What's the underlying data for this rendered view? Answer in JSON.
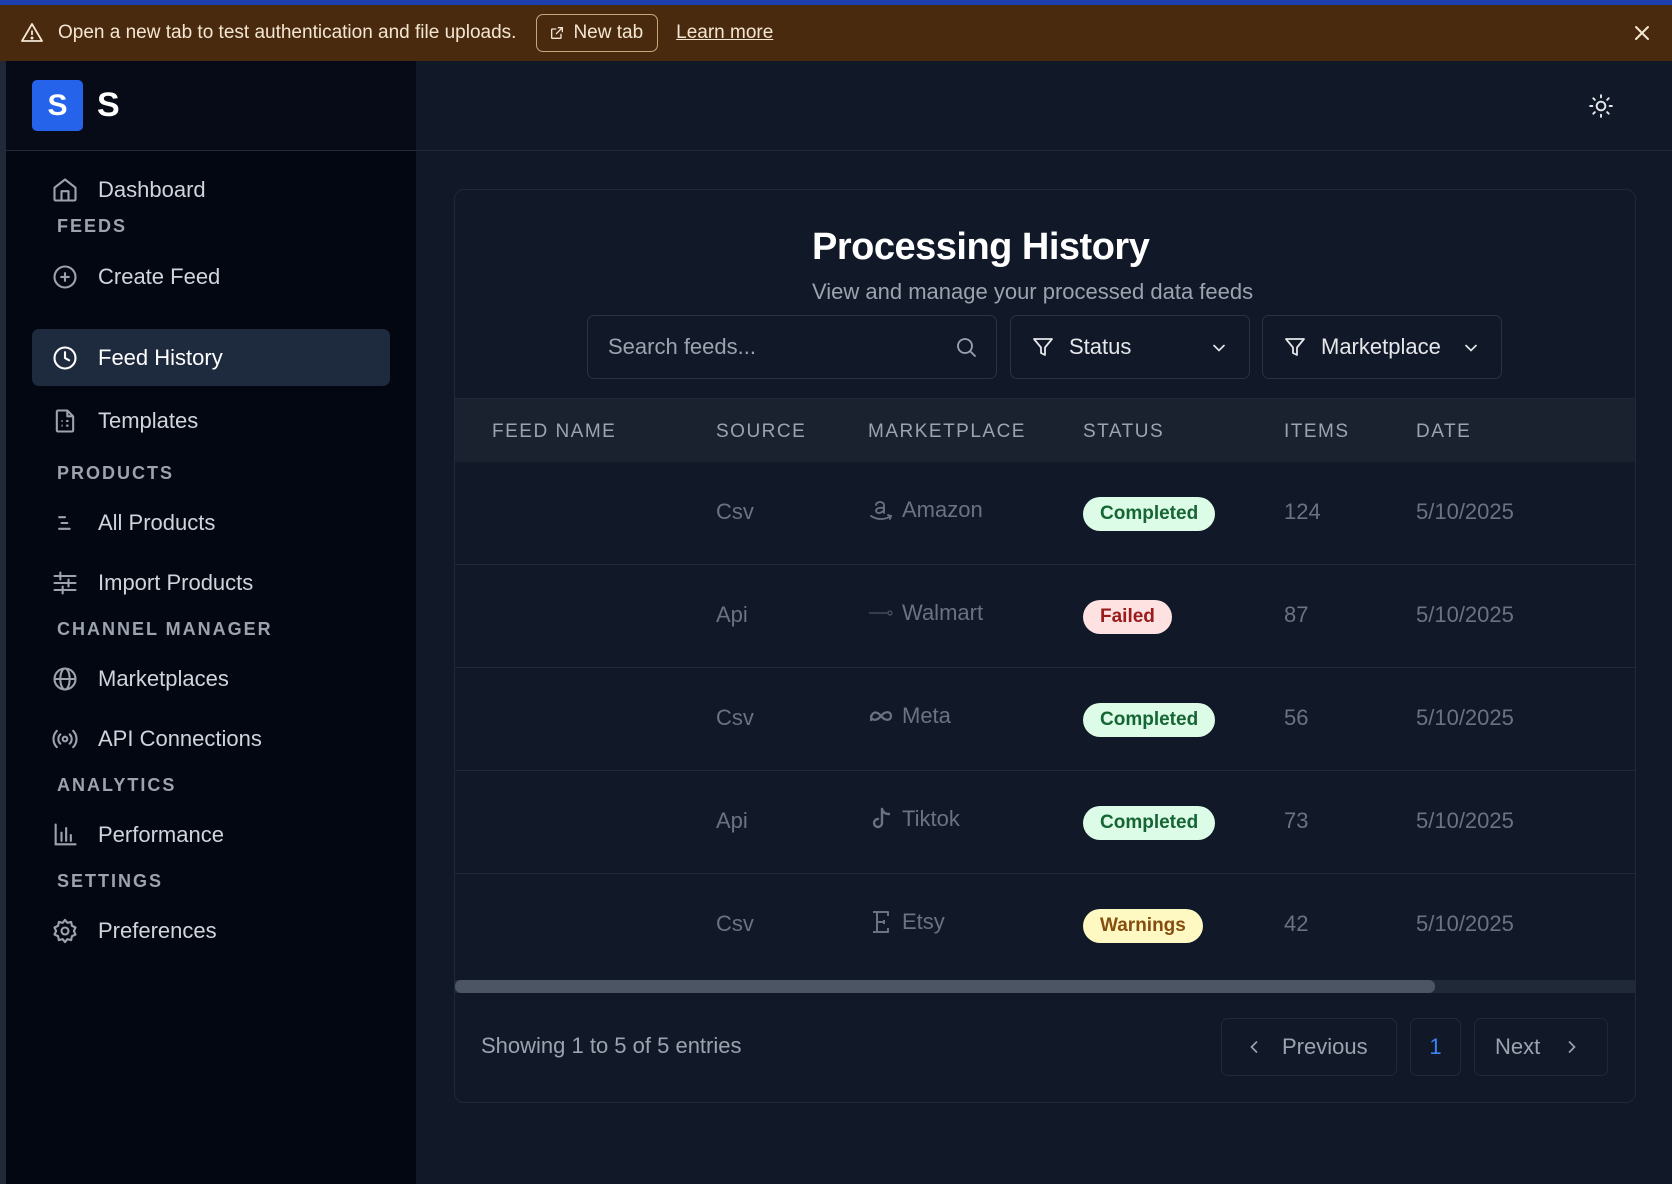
{
  "banner": {
    "message": "Open a new tab to test authentication and file uploads.",
    "new_tab_label": "New tab",
    "learn_more_label": "Learn more"
  },
  "sidebar": {
    "logo_letter": "S",
    "brand": "S",
    "items": {
      "dashboard": "Dashboard",
      "create_feed": "Create Feed",
      "feed_history": "Feed History",
      "templates": "Templates",
      "all_products": "All Products",
      "import_products": "Import Products",
      "marketplaces": "Marketplaces",
      "api_connections": "API Connections",
      "performance": "Performance",
      "preferences": "Preferences"
    },
    "sections": {
      "feeds": "FEEDS",
      "products": "PRODUCTS",
      "channel_manager": "CHANNEL MANAGER",
      "analytics": "ANALYTICS",
      "settings": "SETTINGS"
    },
    "active_item": "feed_history"
  },
  "page": {
    "title": "Processing History",
    "subtitle": "View and manage your processed data feeds"
  },
  "filters": {
    "search_placeholder": "Search feeds...",
    "status_label": "Status",
    "marketplace_label": "Marketplace"
  },
  "table": {
    "headers": {
      "feed_name": "FEED NAME",
      "source": "SOURCE",
      "marketplace": "MARKETPLACE",
      "status": "STATUS",
      "items": "ITEMS",
      "date": "DATE"
    },
    "rows": [
      {
        "feed_name": "",
        "source": "Csv",
        "marketplace": "Amazon",
        "marketplace_icon": "amazon-icon",
        "status": "Completed",
        "status_kind": "completed",
        "items": "124",
        "date": "5/10/2025"
      },
      {
        "feed_name": "",
        "source": "Api",
        "marketplace": "Walmart",
        "marketplace_icon": "walmart-icon",
        "status": "Failed",
        "status_kind": "failed",
        "items": "87",
        "date": "5/10/2025"
      },
      {
        "feed_name": "",
        "source": "Csv",
        "marketplace": "Meta",
        "marketplace_icon": "meta-icon",
        "status": "Completed",
        "status_kind": "completed",
        "items": "56",
        "date": "5/10/2025"
      },
      {
        "feed_name": "",
        "source": "Api",
        "marketplace": "Tiktok",
        "marketplace_icon": "tiktok-icon",
        "status": "Completed",
        "status_kind": "completed",
        "items": "73",
        "date": "5/10/2025"
      },
      {
        "feed_name": "",
        "source": "Csv",
        "marketplace": "Etsy",
        "marketplace_icon": "etsy-icon",
        "status": "Warnings",
        "status_kind": "warnings",
        "items": "42",
        "date": "5/10/2025"
      }
    ]
  },
  "pagination": {
    "summary": "Showing 1 to 5 of 5 entries",
    "previous_label": "Previous",
    "current_page": "1",
    "next_label": "Next"
  },
  "colors": {
    "banner_bg": "#4a2a0e",
    "accent": "#2563eb",
    "completed_bg": "#dcfce7",
    "failed_bg": "#fee2e2",
    "warnings_bg": "#fef9c3"
  }
}
